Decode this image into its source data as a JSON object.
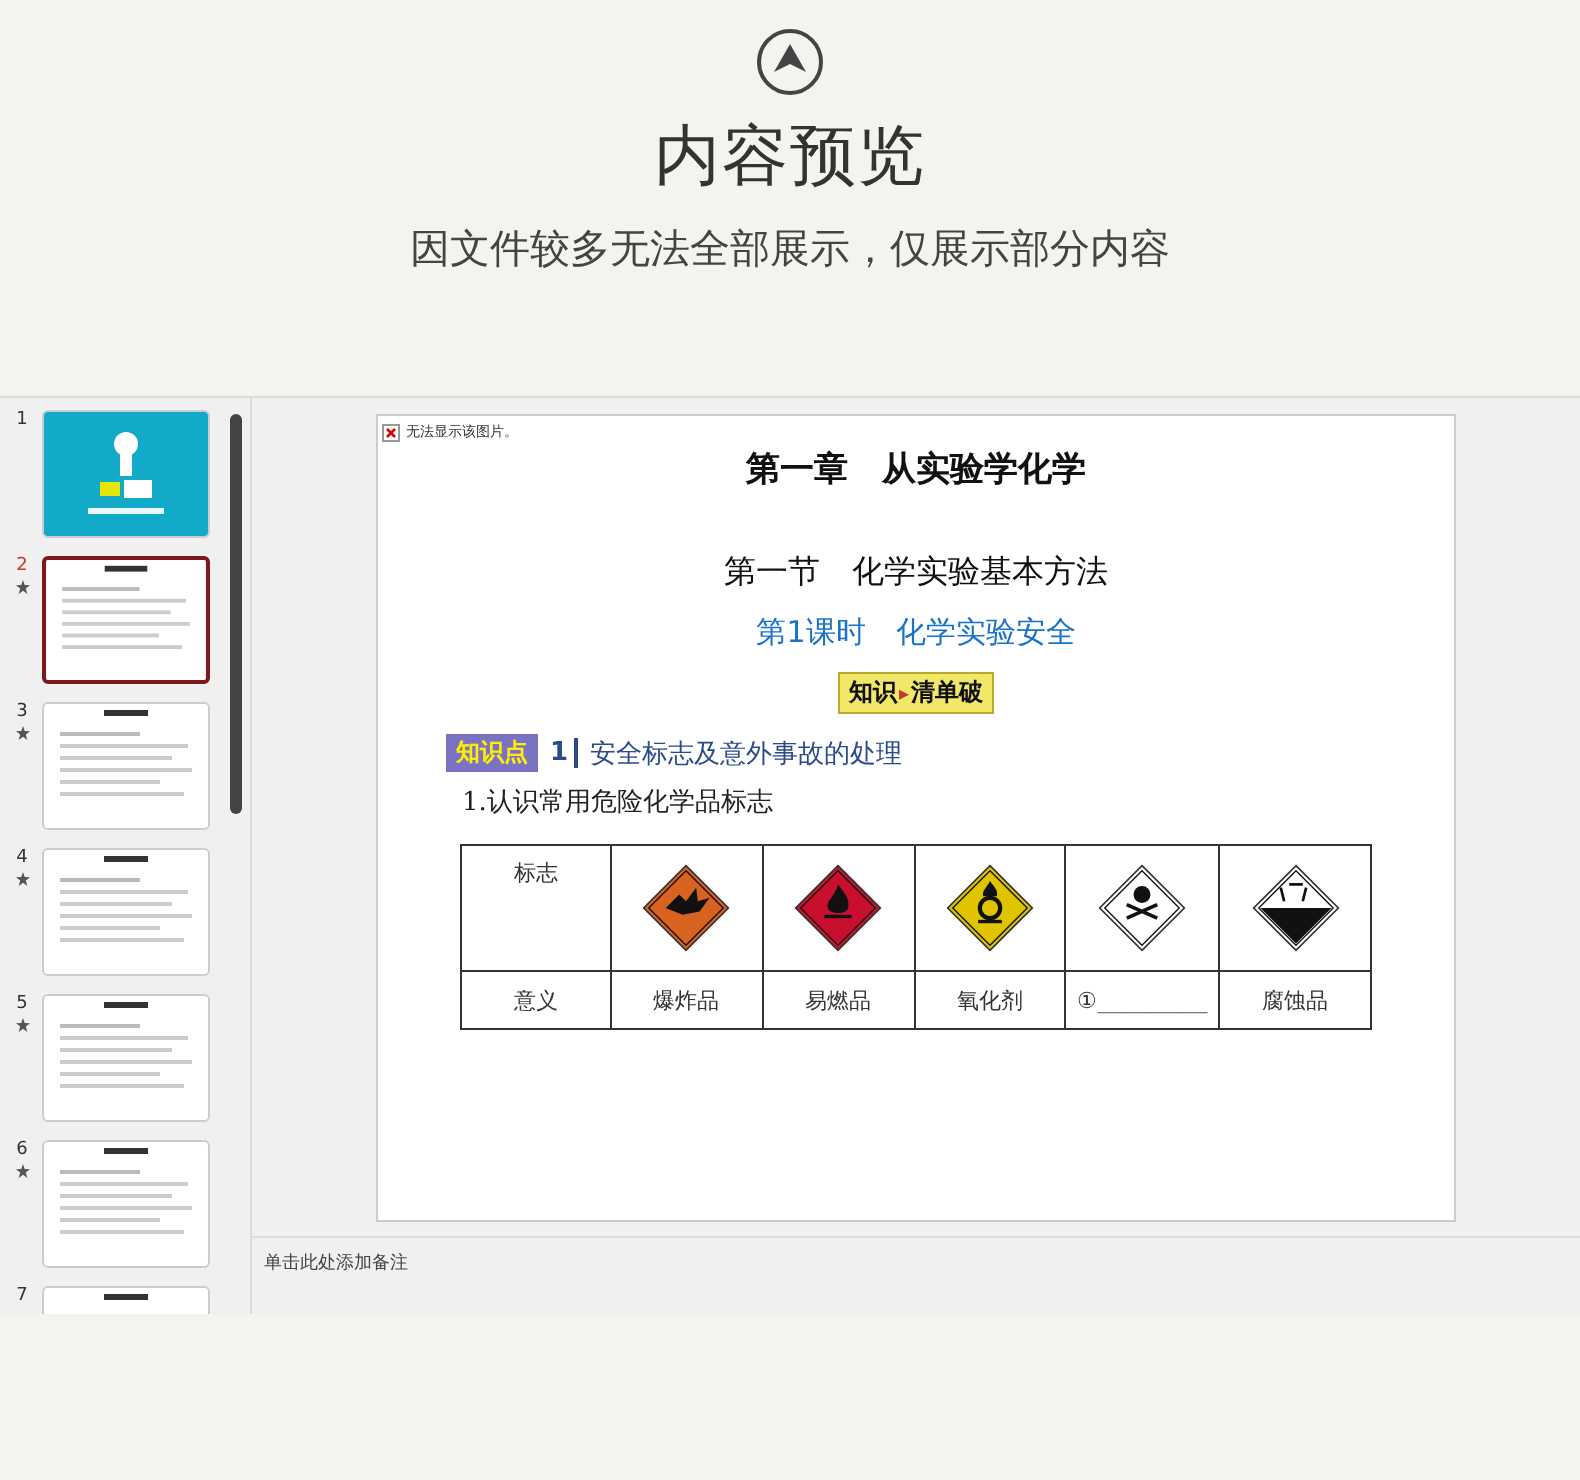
{
  "header": {
    "title": "内容预览",
    "subtitle": "因文件较多无法全部展示，仅展示部分内容"
  },
  "thumbnails": [
    {
      "number": "1",
      "kind": "cover",
      "selected": false,
      "starred": false
    },
    {
      "number": "2",
      "kind": "content",
      "selected": true,
      "starred": true
    },
    {
      "number": "3",
      "kind": "content",
      "selected": false,
      "starred": true
    },
    {
      "number": "4",
      "kind": "content",
      "selected": false,
      "starred": true
    },
    {
      "number": "5",
      "kind": "content",
      "selected": false,
      "starred": true
    },
    {
      "number": "6",
      "kind": "content",
      "selected": false,
      "starred": true
    },
    {
      "number": "7",
      "kind": "content",
      "selected": false,
      "starred": false
    }
  ],
  "slide": {
    "broken_image_text": "无法显示该图片。",
    "chapter_title": "第一章　从实验学化学",
    "section_title": "第一节　化学实验基本方法",
    "lesson_title": "第1课时　化学实验安全",
    "badge": {
      "left": "知识",
      "separator": "▸",
      "right": "清单破"
    },
    "knowledge_point": {
      "tag": "知识点",
      "number": "1",
      "text": "安全标志及意外事故的处理"
    },
    "item": "1.认识常用危险化学品标志",
    "table": {
      "sign_label": "标志",
      "signs": [
        {
          "kind": "explosive"
        },
        {
          "kind": "flammable"
        },
        {
          "kind": "oxidizer"
        },
        {
          "kind": "toxic"
        },
        {
          "kind": "corrosive"
        }
      ],
      "meaning_row": [
        "意义",
        "爆炸品",
        "易燃品",
        "氧化剂",
        "①__________",
        "腐蚀品"
      ]
    }
  },
  "notes": {
    "placeholder": "单击此处添加备注"
  }
}
